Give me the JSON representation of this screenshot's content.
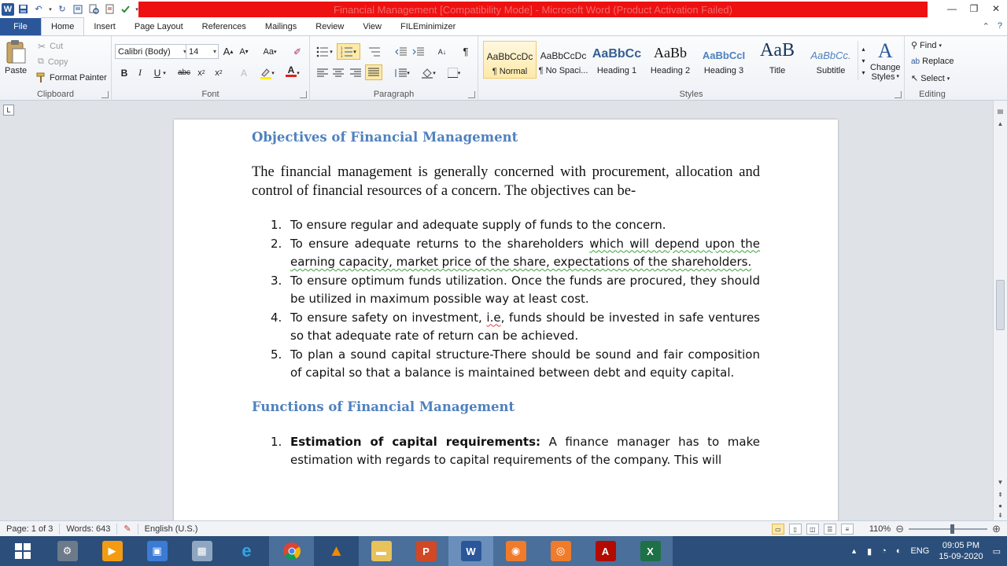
{
  "title_bar": {
    "title": "Financial Management [Compatibility Mode] - Microsoft Word (Product Activation Failed)"
  },
  "tabs": [
    {
      "label": "File"
    },
    {
      "label": "Home"
    },
    {
      "label": "Insert"
    },
    {
      "label": "Page Layout"
    },
    {
      "label": "References"
    },
    {
      "label": "Mailings"
    },
    {
      "label": "Review"
    },
    {
      "label": "View"
    },
    {
      "label": "FILEminimizer"
    }
  ],
  "ribbon": {
    "clipboard": {
      "paste": "Paste",
      "cut": "Cut",
      "copy": "Copy",
      "format_painter": "Format Painter",
      "label": "Clipboard"
    },
    "font": {
      "name": "Calibri (Body)",
      "size": "14",
      "label": "Font"
    },
    "paragraph": {
      "label": "Paragraph"
    },
    "styles": {
      "label": "Styles",
      "tiles": [
        {
          "preview": "AaBbCcDc",
          "name": "¶ Normal"
        },
        {
          "preview": "AaBbCcDc",
          "name": "¶ No Spaci..."
        },
        {
          "preview": "AaBbCc",
          "name": "Heading 1"
        },
        {
          "preview": "AaBb",
          "name": "Heading 2"
        },
        {
          "preview": "AaBbCcI",
          "name": "Heading 3"
        },
        {
          "preview": "AaB",
          "name": "Title"
        },
        {
          "preview": "AaBbCc.",
          "name": "Subtitle"
        }
      ],
      "change_styles_1": "Change",
      "change_styles_2": "Styles"
    },
    "editing": {
      "find": "Find",
      "replace": "Replace",
      "select": "Select",
      "label": "Editing"
    }
  },
  "document": {
    "heading1": "Objectives of Financial Management",
    "intro": "The financial management is generally concerned with procurement, allocation and control of financial resources of a concern. The objectives can be-",
    "objectives": [
      {
        "num": "1.",
        "text": "To ensure regular and adequate supply of funds to the concern."
      },
      {
        "num": "2.",
        "text_a": "To ensure adequate returns to the shareholders ",
        "text_b": "which will depend upon the earning capacity, market price of the share, expectations of the shareholders."
      },
      {
        "num": "3.",
        "text": "To ensure optimum funds utilization. Once the funds are procured, they should be utilized in maximum possible way at least cost."
      },
      {
        "num": "4.",
        "text_a": "To ensure safety on investment, ",
        "text_b": "i.e",
        "text_c": ", funds should be invested in safe ventures so that adequate rate of return can be achieved."
      },
      {
        "num": "5.",
        "text": "To plan a sound capital structure-There should be sound and fair composition of capital so that a balance is maintained between debt and equity capital."
      }
    ],
    "heading2": "Functions of Financial Management",
    "functions": [
      {
        "num": "1.",
        "bold": "Estimation of capital requirements:",
        "text": " A finance manager has to make estimation with regards to capital requirements of the company. This will"
      }
    ]
  },
  "status_bar": {
    "page": "Page: 1 of 3",
    "words": "Words: 643",
    "language": "English (U.S.)",
    "zoom": "110%",
    "zoom_fraction": 0.55
  },
  "taskbar": {
    "lang": "ENG",
    "time": "09:05 PM",
    "date": "15-09-2020"
  }
}
